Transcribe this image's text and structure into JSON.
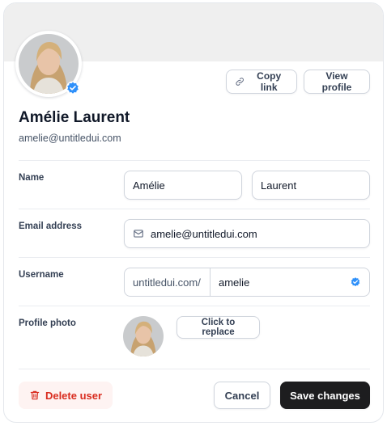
{
  "profile": {
    "full_name": "Amélie Laurent",
    "email": "amelie@untitledui.com"
  },
  "actions": {
    "copy_link": "Copy link",
    "view_profile": "View profile"
  },
  "form": {
    "name_label": "Name",
    "first_name": "Amélie",
    "last_name": "Laurent",
    "email_label": "Email address",
    "email_value": "amelie@untitledui.com",
    "username_label": "Username",
    "username_prefix": "untitledui.com/",
    "username_value": "amelie",
    "photo_label": "Profile photo",
    "replace_label": "Click to replace"
  },
  "footer": {
    "delete_label": "Delete user",
    "cancel_label": "Cancel",
    "save_label": "Save changes"
  },
  "colors": {
    "verified": "#2e90fa",
    "danger": "#d92d20",
    "danger_bg": "#fef3f2",
    "primary_button": "#1d1d1f"
  },
  "icons": {
    "verified": "verified-check-icon",
    "link": "link-icon",
    "mail": "mail-icon",
    "trash": "trash-icon"
  }
}
